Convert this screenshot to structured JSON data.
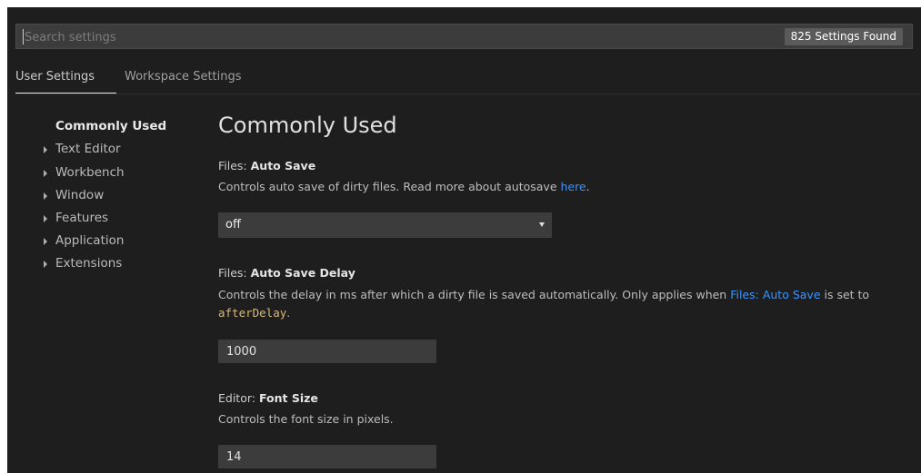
{
  "search": {
    "placeholder": "Search settings",
    "value": "",
    "results_count": "825 Settings Found"
  },
  "tabs": [
    {
      "label": "User Settings",
      "active": true
    },
    {
      "label": "Workspace Settings",
      "active": false
    }
  ],
  "toc": {
    "items": [
      {
        "label": "Commonly Used",
        "active": true,
        "expandable": false
      },
      {
        "label": "Text Editor",
        "active": false,
        "expandable": true
      },
      {
        "label": "Workbench",
        "active": false,
        "expandable": true
      },
      {
        "label": "Window",
        "active": false,
        "expandable": true
      },
      {
        "label": "Features",
        "active": false,
        "expandable": true
      },
      {
        "label": "Application",
        "active": false,
        "expandable": true
      },
      {
        "label": "Extensions",
        "active": false,
        "expandable": true
      }
    ]
  },
  "main": {
    "section_title": "Commonly Used",
    "settings": [
      {
        "category": "Files: ",
        "key": "Auto Save",
        "desc_before": "Controls auto save of dirty files. Read more about autosave ",
        "desc_link": "here",
        "desc_after": ".",
        "control": "dropdown",
        "value": "off"
      },
      {
        "category": "Files: ",
        "key": "Auto Save Delay",
        "desc_before": "Controls the delay in ms after which a dirty file is saved automatically. Only applies when ",
        "desc_link": "Files: Auto Save",
        "desc_middle": " is set to ",
        "desc_code": "afterDelay",
        "desc_after": ".",
        "control": "number",
        "value": "1000"
      },
      {
        "category": "Editor: ",
        "key": "Font Size",
        "desc": "Controls the font size in pixels.",
        "control": "number",
        "value": "14"
      }
    ]
  },
  "colors": {
    "background": "#1e1e1e",
    "input_background": "#3c3c3c",
    "link": "#3794ff",
    "code": "#d7ba7d",
    "badge": "#5a5a5a"
  },
  "icons": {
    "toc_expand": "chevron-right-icon",
    "dropdown": "chevron-down-icon"
  }
}
